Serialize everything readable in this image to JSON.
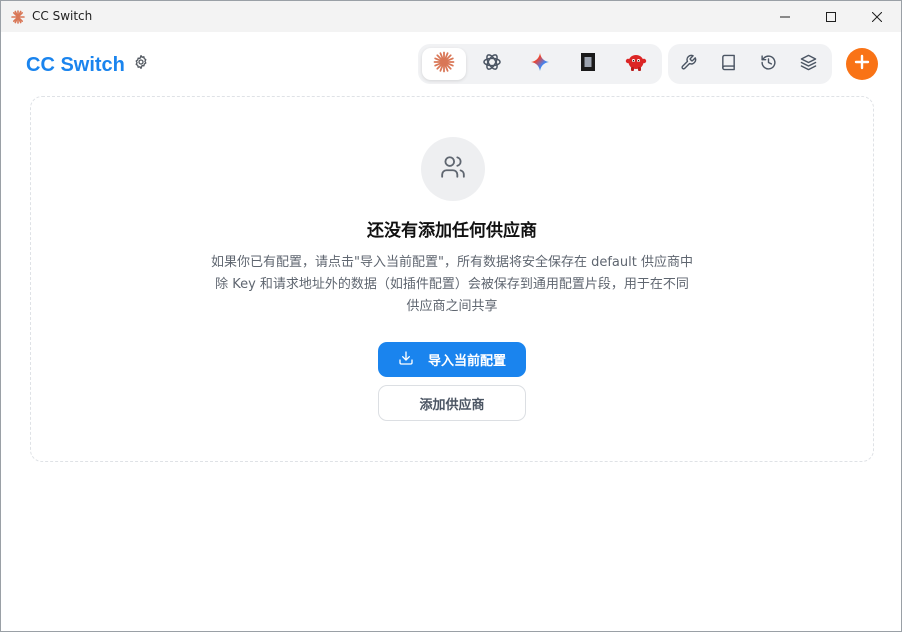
{
  "window": {
    "title": "CC Switch"
  },
  "header": {
    "brand": "CC Switch",
    "settings_icon": "gear-icon",
    "apps": [
      {
        "name": "claude",
        "icon": "claude-icon",
        "active": true
      },
      {
        "name": "codex",
        "icon": "openai-icon",
        "active": false
      },
      {
        "name": "gemini",
        "icon": "gemini-icon",
        "active": false
      },
      {
        "name": "opencode",
        "icon": "opencode-icon",
        "active": false
      },
      {
        "name": "droid",
        "icon": "red-mascot-icon",
        "active": false
      }
    ],
    "tools": [
      {
        "icon": "wrench-icon"
      },
      {
        "icon": "book-icon"
      },
      {
        "icon": "history-icon"
      },
      {
        "icon": "layers-icon"
      }
    ],
    "add_icon": "plus-icon"
  },
  "empty_state": {
    "icon": "users-icon",
    "title": "还没有添加任何供应商",
    "description_lines": [
      "如果你已有配置，请点击\"导入当前配置\"，所有数据将安全保存在 default 供应商中",
      "除 Key 和请求地址外的数据（如插件配置）会被保存到通用配置片段，用于在不同",
      "供应商之间共享"
    ],
    "import_button": "导入当前配置",
    "add_provider_button": "添加供应商"
  },
  "colors": {
    "brand": "#1a84ee",
    "primary_button": "#1a84ee",
    "add_button": "#f97316"
  }
}
